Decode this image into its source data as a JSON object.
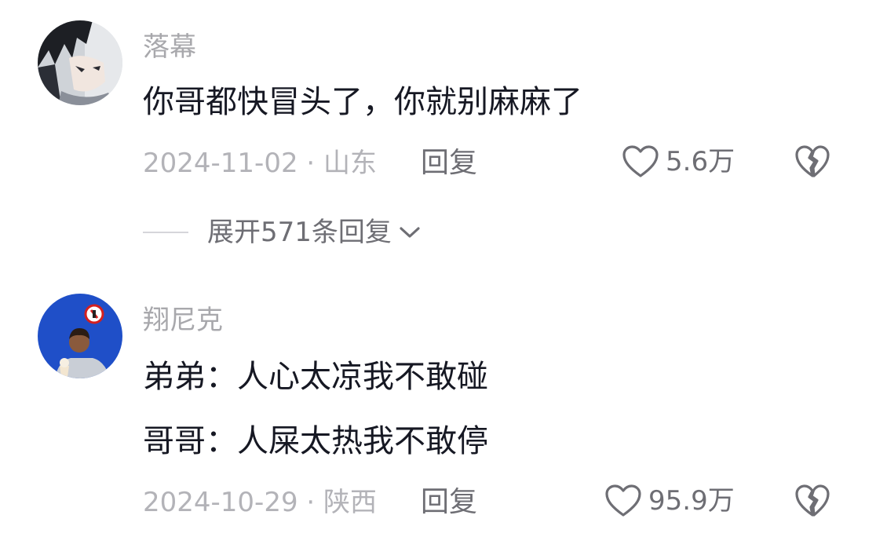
{
  "comments": [
    {
      "username": "落幕",
      "lines": [
        "你哥都快冒头了，你就别麻麻了"
      ],
      "date": "2024-11-02",
      "separator": "·",
      "location": "山东",
      "reply_label": "回复",
      "likes": "5.6万",
      "avatar_icon": "anime-avatar-icon"
    },
    {
      "username": "翔尼克",
      "lines": [
        "弟弟：人心太凉我不敢碰",
        "哥哥：人屎太热我不敢停"
      ],
      "date": "2024-10-29",
      "separator": "·",
      "location": "陕西",
      "reply_label": "回复",
      "likes": "95.9万",
      "avatar_icon": "photo-avatar-icon"
    }
  ],
  "expand_replies": {
    "label": "展开571条回复",
    "icon": "chevron-down-icon"
  },
  "colors": {
    "username": "#a8a8ac",
    "text": "#161823",
    "meta": "#b3b3b8",
    "action": "#6e6e74",
    "avatar2_bg": "#1f4fc8"
  }
}
